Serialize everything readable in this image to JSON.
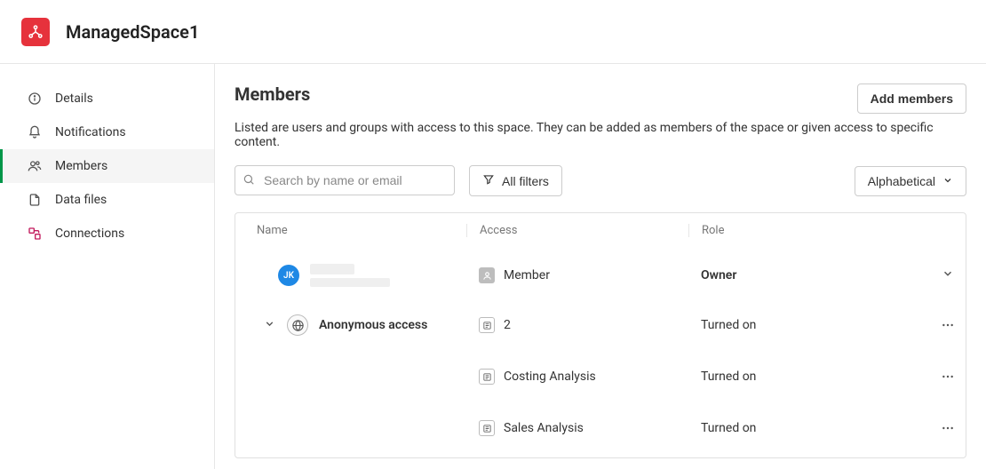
{
  "header": {
    "title": "ManagedSpace1"
  },
  "sidebar": {
    "items": [
      {
        "label": "Details"
      },
      {
        "label": "Notifications"
      },
      {
        "label": "Members"
      },
      {
        "label": "Data files"
      },
      {
        "label": "Connections"
      }
    ]
  },
  "page": {
    "title": "Members",
    "description": "Listed are users and groups with access to this space. They can be added as members of the space or given access to specific content.",
    "add_members_label": "Add members"
  },
  "toolbar": {
    "search_placeholder": "Search by name or email",
    "filters_label": "All filters",
    "sort_label": "Alphabetical"
  },
  "table": {
    "columns": {
      "name": "Name",
      "access": "Access",
      "role": "Role"
    },
    "rows": [
      {
        "avatar_initials": "JK",
        "access_label": "Member",
        "role": "Owner"
      },
      {
        "name": "Anonymous access",
        "access_label": "2",
        "role": "Turned on"
      },
      {
        "name": "",
        "access_label": "Costing Analysis",
        "role": "Turned on"
      },
      {
        "name": "",
        "access_label": "Sales Analysis",
        "role": "Turned on"
      }
    ]
  }
}
